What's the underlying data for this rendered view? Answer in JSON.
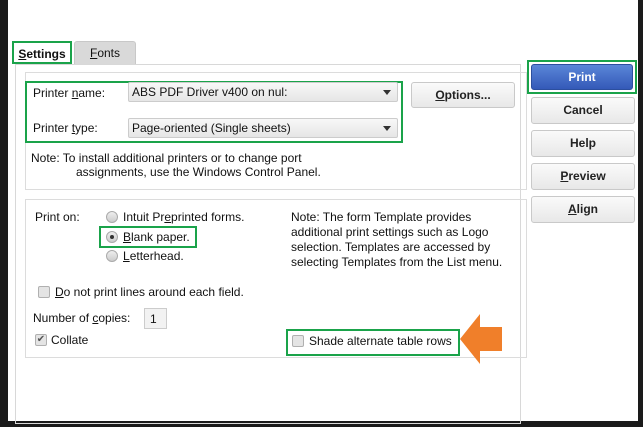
{
  "tabs": [
    {
      "label": "Settings",
      "key": "S",
      "rest": "ettings"
    },
    {
      "label": "Fonts",
      "key": "F",
      "rest": "onts"
    }
  ],
  "printer": {
    "name_label_pre": "Printer ",
    "name_label_key": "n",
    "name_label_post": "ame:",
    "name_value": "ABS PDF Driver v400 on nul:",
    "type_label_pre": "Printer ",
    "type_label_key": "t",
    "type_label_post": "ype:",
    "type_value": "Page-oriented (Single sheets)",
    "options_key": "O",
    "options_rest": "ptions...",
    "note_line1": "Note: To install additional printers or to change port",
    "note_line2": "assignments, use the Windows Control Panel."
  },
  "print_on": {
    "label": "Print on:",
    "options": [
      {
        "pre": "Intuit Pr",
        "key": "e",
        "post": "printed forms.",
        "selected": false
      },
      {
        "pre": "",
        "key": "B",
        "post": "lank paper.",
        "selected": true
      },
      {
        "pre": "",
        "key": "L",
        "post": "etterhead.",
        "selected": false
      }
    ],
    "note": [
      "Note: The form Template provides",
      "additional print settings such as Logo",
      "selection.  Templates are accessed by",
      "selecting Templates from the List menu."
    ]
  },
  "no_lines": {
    "key": "D",
    "rest": "o not print lines around each field.",
    "checked": false
  },
  "copies": {
    "label_pre": "Number of ",
    "label_key": "c",
    "label_post": "opies:",
    "value": "1"
  },
  "collate": {
    "label": "Collate",
    "checked": true
  },
  "shade": {
    "label": "Shade alternate table rows",
    "checked": false
  },
  "buttons": {
    "print": "Print",
    "cancel": "Cancel",
    "help": "Help",
    "preview_key": "P",
    "preview_rest": "review",
    "align_key": "A",
    "align_rest": "lign"
  },
  "colors": {
    "highlight": "#1aa34a",
    "arrow": "#f07f2a",
    "primary": "#3d68c4"
  }
}
